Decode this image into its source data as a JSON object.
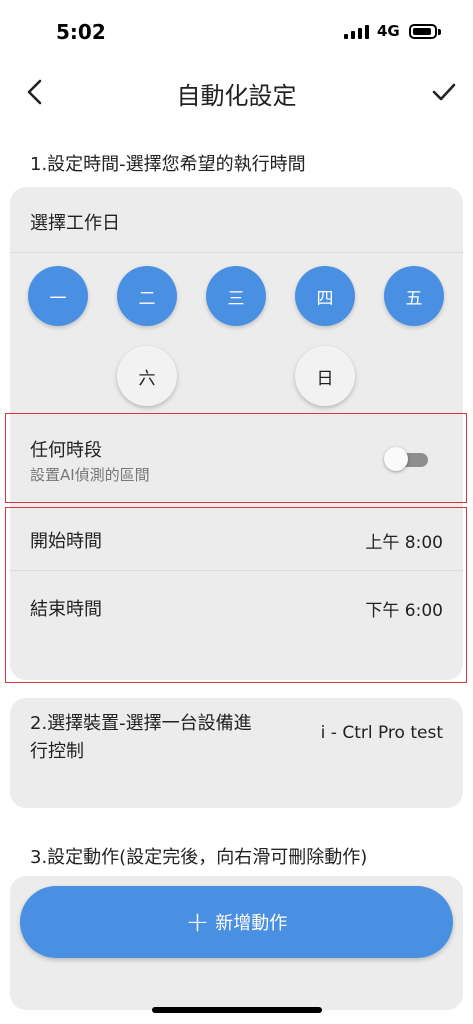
{
  "status_bar": {
    "time": "5:02",
    "network": "4G"
  },
  "header": {
    "title": "自動化設定",
    "back_icon": "chevron-left-icon",
    "confirm_icon": "checkmark-icon"
  },
  "section1": {
    "heading": "1.設定時間-選擇您希望的執行時間",
    "weekday_title": "選擇工作日",
    "days": [
      {
        "label": "一",
        "selected": true
      },
      {
        "label": "二",
        "selected": true
      },
      {
        "label": "三",
        "selected": true
      },
      {
        "label": "四",
        "selected": true
      },
      {
        "label": "五",
        "selected": true
      },
      {
        "label": "六",
        "selected": false
      },
      {
        "label": "日",
        "selected": false
      }
    ],
    "any_time": {
      "label": "任何時段",
      "sub": "設置AI偵測的區間",
      "enabled": false
    },
    "start": {
      "label": "開始時間",
      "value": "上午 8:00"
    },
    "end": {
      "label": "結束時間",
      "value": "下午 6:00"
    }
  },
  "section2": {
    "heading_line1": "2.選擇裝置-選擇一台設備進",
    "heading_line2": "行控制",
    "device": "i - Ctrl Pro test"
  },
  "section3": {
    "heading": "3.設定動作(設定完後，向右滑可刪除動作)",
    "add_button": "新增動作",
    "add_icon": "plus-icon"
  },
  "colors": {
    "accent": "#4a90e2",
    "card": "#ececec",
    "highlight_border": "#d9373b"
  }
}
